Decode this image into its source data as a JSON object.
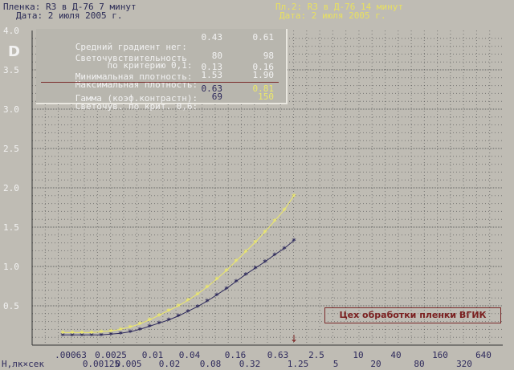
{
  "header": {
    "film1": "Пленка: R3 в Д-76 7 минут",
    "date1": "Дата: 2 июля 2005 г.",
    "film2": "Пл.2: R3 в Д-76 14 минут",
    "date2": "Дата: 2 июля 2005 г."
  },
  "info": {
    "rows": [
      {
        "label": "Средний градиент нег:",
        "v1": "0.43",
        "v2": "0.61"
      },
      {
        "label": "Светочувствительность",
        "v1": "",
        "v2": ""
      },
      {
        "label": "      по критерию 0,1:",
        "v1": "80",
        "v2": "98"
      },
      {
        "label": "Минимальная плотность:",
        "v1": "0.13",
        "v2": "0.16"
      },
      {
        "label": "Максимальная плотность:",
        "v1": "1.53",
        "v2": "1.90"
      },
      {
        "label": "Гамма (коэф.контрастн):",
        "v1": "0.63",
        "v2": "0.81"
      },
      {
        "label": "Светочув. по крит. 0,6:",
        "v1": "69",
        "v2": "150"
      }
    ]
  },
  "stamp": "Цех обработки пленки ВГИК",
  "colors": {
    "series1": "#2e2a5c",
    "series2": "#ece86a",
    "grid": "#5a5a5a",
    "arrow": "#7a1f1f"
  },
  "chart_data": {
    "type": "line",
    "ylabel": "D",
    "xlabel": "Н,лк×сек",
    "ylim": [
      0,
      4.0
    ],
    "y_ticks": [
      "4.0",
      "3.5",
      "3.0",
      "2.5",
      "2.0",
      "1.5",
      "1.0",
      "0.5"
    ],
    "x_ticks_top": [
      ".00063",
      "0.0025",
      "0.01",
      "0.04",
      "0.16",
      "0.63",
      "2.5",
      "10",
      "40",
      "160",
      "640"
    ],
    "x_ticks_bottom": [
      "0.00125",
      "0.005",
      "0.02",
      "0.08",
      "0.32",
      "1.25",
      "5",
      "20",
      "80",
      "320"
    ],
    "arrow_marker": "↓",
    "series": [
      {
        "values": [
          0.13,
          0.13,
          0.13,
          0.13,
          0.13,
          0.14,
          0.15,
          0.17,
          0.2,
          0.24,
          0.28,
          0.32,
          0.37,
          0.43,
          0.49,
          0.56,
          0.64,
          0.72,
          0.81,
          0.9,
          0.98,
          1.06,
          1.15,
          1.23,
          1.33
        ],
        "x_step_index": true
      },
      {
        "values": [
          0.16,
          0.16,
          0.16,
          0.16,
          0.17,
          0.18,
          0.2,
          0.23,
          0.27,
          0.32,
          0.38,
          0.44,
          0.5,
          0.57,
          0.65,
          0.74,
          0.84,
          0.95,
          1.07,
          1.19,
          1.31,
          1.44,
          1.58,
          1.72,
          1.9
        ],
        "x_step_index": true
      }
    ]
  }
}
